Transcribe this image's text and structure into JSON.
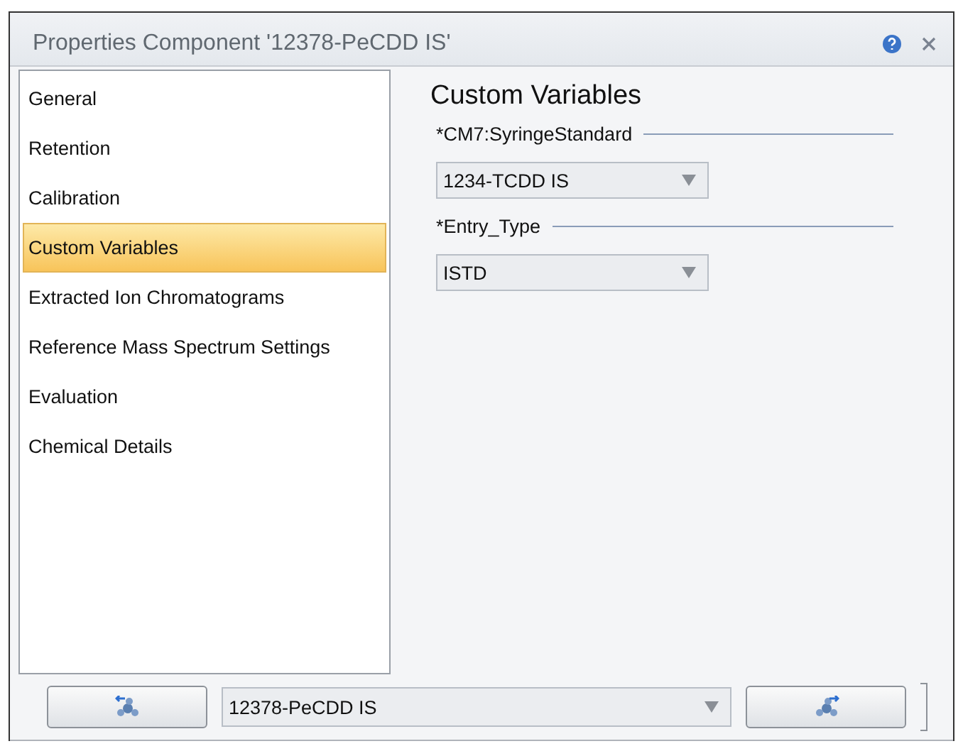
{
  "window": {
    "title": "Properties Component '12378-PeCDD IS'"
  },
  "sidebar": {
    "items": [
      {
        "label": "General",
        "selected": false
      },
      {
        "label": "Retention",
        "selected": false
      },
      {
        "label": "Calibration",
        "selected": false
      },
      {
        "label": "Custom Variables",
        "selected": true
      },
      {
        "label": "Extracted Ion Chromatograms",
        "selected": false
      },
      {
        "label": "Reference Mass Spectrum Settings",
        "selected": false
      },
      {
        "label": "Evaluation",
        "selected": false
      },
      {
        "label": "Chemical Details",
        "selected": false
      }
    ]
  },
  "panel": {
    "title": "Custom Variables",
    "fields": [
      {
        "label": "*CM7:SyringeStandard",
        "value": "1234-TCDD IS"
      },
      {
        "label": "*Entry_Type",
        "value": "ISTD"
      }
    ]
  },
  "footer": {
    "component": "12378-PeCDD IS"
  }
}
